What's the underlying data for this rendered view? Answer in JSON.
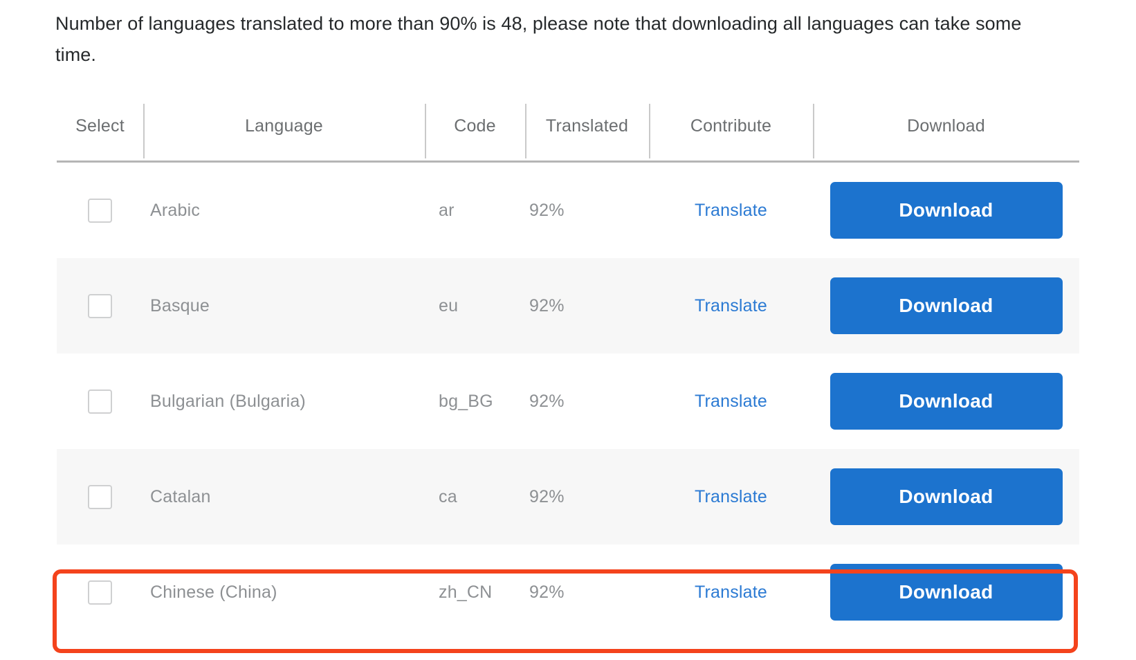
{
  "intro": {
    "text": "Number of languages translated to more than 90% is 48, please note that downloading all languages can take some time."
  },
  "table": {
    "columns": [
      {
        "key": "select",
        "label": "Select"
      },
      {
        "key": "language",
        "label": "Language"
      },
      {
        "key": "code",
        "label": "Code"
      },
      {
        "key": "translated",
        "label": "Translated"
      },
      {
        "key": "contribute",
        "label": "Contribute"
      },
      {
        "key": "download",
        "label": "Download"
      }
    ],
    "rows": [
      {
        "language": "Arabic",
        "code": "ar",
        "translated": "92%",
        "contribute_label": "Translate",
        "download_label": "Download",
        "selected": false,
        "striped": false,
        "highlighted": false
      },
      {
        "language": "Basque",
        "code": "eu",
        "translated": "92%",
        "contribute_label": "Translate",
        "download_label": "Download",
        "selected": false,
        "striped": true,
        "highlighted": false
      },
      {
        "language": "Bulgarian (Bulgaria)",
        "code": "bg_BG",
        "translated": "92%",
        "contribute_label": "Translate",
        "download_label": "Download",
        "selected": false,
        "striped": false,
        "highlighted": false
      },
      {
        "language": "Catalan",
        "code": "ca",
        "translated": "92%",
        "contribute_label": "Translate",
        "download_label": "Download",
        "selected": false,
        "striped": true,
        "highlighted": false
      },
      {
        "language": "Chinese (China)",
        "code": "zh_CN",
        "translated": "92%",
        "contribute_label": "Translate",
        "download_label": "Download",
        "selected": false,
        "striped": false,
        "highlighted": true
      }
    ]
  },
  "colors": {
    "download_button": "#1c73ce",
    "translate_link": "#2b7ad3",
    "highlight_outline": "#f4431c",
    "header_text": "#6b6e70",
    "body_text": "#8d9093",
    "stripe_background": "#f7f7f7"
  }
}
